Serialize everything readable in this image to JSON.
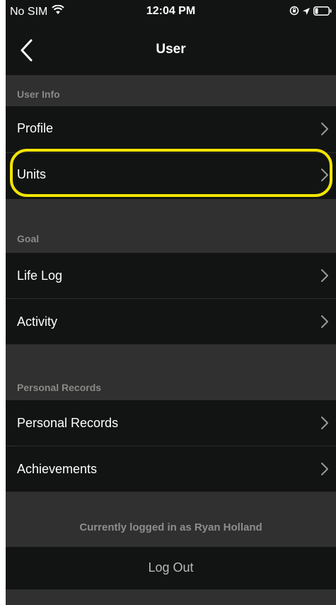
{
  "status_bar": {
    "carrier": "No SIM",
    "time": "12:04 PM",
    "icons": [
      "wifi-icon",
      "rotation-lock-icon",
      "location-icon",
      "battery-icon"
    ]
  },
  "nav": {
    "title": "User",
    "back_icon": "chevron-left-icon"
  },
  "sections": [
    {
      "header": "User Info",
      "rows": [
        {
          "label": "Profile"
        },
        {
          "label": "Units"
        }
      ]
    },
    {
      "header": "Goal",
      "rows": [
        {
          "label": "Life Log"
        },
        {
          "label": "Activity"
        }
      ]
    },
    {
      "header": "Personal Records",
      "rows": [
        {
          "label": "Personal Records"
        },
        {
          "label": "Achievements"
        }
      ]
    }
  ],
  "footer": {
    "logged_in_text": "Currently logged in as Ryan Holland",
    "logout_label": "Log Out"
  },
  "colors": {
    "background": "#2f302f",
    "row_background": "#121413",
    "header_text": "#8a8a88",
    "highlight": "#f2e400"
  }
}
